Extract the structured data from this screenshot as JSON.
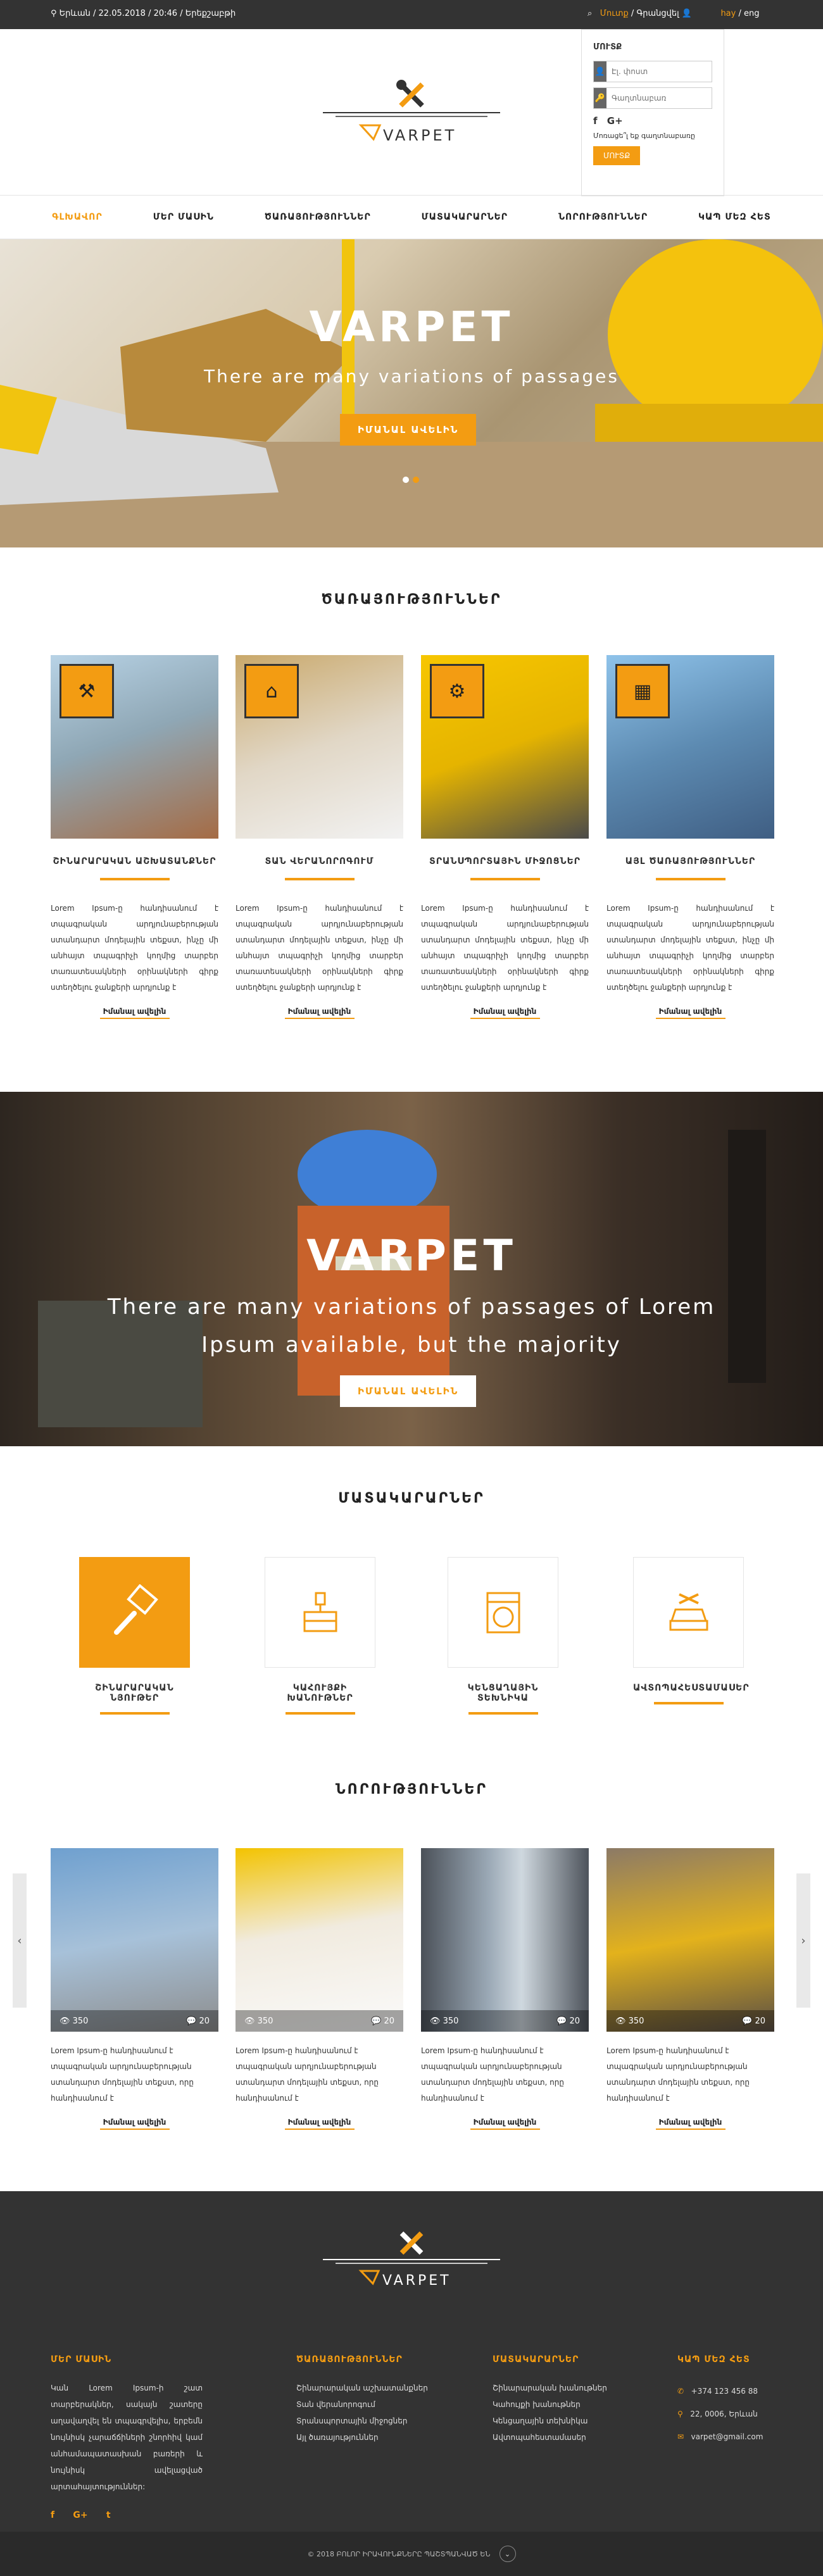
{
  "topbar": {
    "location": "Երևան / 22.05.2018 / 20:46 / Երեքշաբթի",
    "login": "Մուտք",
    "separator": " / ",
    "register": "Գրանցվել",
    "lang_hy": "hay",
    "lang_sep": " / ",
    "lang_en": "eng"
  },
  "login_panel": {
    "title": "ՄՈՒՏՔ",
    "email_placeholder": "Էլ. փոստ",
    "password_placeholder": "Գաղտնաբառ",
    "facebook": "f",
    "google": "G+",
    "forgot": "Մոռացե՞լ եք գաղտնաբառը",
    "button": "ՄՈՒՏՔ"
  },
  "logo": {
    "text": "VARPET"
  },
  "nav": {
    "items": [
      "ԳԼԽԱՎՈՐ",
      "ՄԵՐ ՄԱՍԻՆ",
      "ԾԱՌԱՅՈՒԹՅՈՒՆՆԵՐ",
      "ՄԱՏԱԿԱՐԱՐՆԵՐ",
      "ՆՈՐՈՒԹՅՈՒՆՆԵՐ",
      "ԿԱՊ ՄԵԶ ՀԵՏ"
    ]
  },
  "hero1": {
    "title": "VARPET",
    "subtitle": "There are many variations of passages",
    "button": "ԻՄԱՆԱԼ ԱՎԵԼԻՆ"
  },
  "services": {
    "title": "ԾԱՌԱՅՈՒԹՅՈՒՆՆԵՐ",
    "cards": [
      {
        "title": "ՇԻՆԱՐԱՐԱԿԱՆ ԱՇԽԱՏԱՆՔՆԵՐ",
        "text": "Lorem Ipsum-ը հանդիսանում է տպագրական արդյունաբերության ստանդարտ մոդելային տեքստ, ինչը մի անհայտ տպագրիչի կողմից տարբեր տառատեսակների օրինակների գիրք ստեղծելու ջանքերի արդյունք է",
        "more": "Իմանալ ավելին",
        "icon": "tools-icon"
      },
      {
        "title": "ՏԱՆ ՎԵՐԱՆՈՐՈԳՈՒՄ",
        "text": "Lorem Ipsum-ը հանդիսանում է տպագրական արդյունաբերության ստանդարտ մոդելային տեքստ, ինչը մի անհայտ տպագրիչի կողմից տարբեր տառատեսակների օրինակների գիրք ստեղծելու ջանքերի արդյունք է",
        "more": "Իմանալ ավելին",
        "icon": "house-icon"
      },
      {
        "title": "ՏՐԱՆՍՊՈՐՏԱՅԻՆ ՄԻՋՈՑՆԵՐ",
        "text": "Lorem Ipsum-ը հանդիսանում է տպագրական արդյունաբերության ստանդարտ մոդելային տեքստ, ինչը մի անհայտ տպագրիչի կողմից տարբեր տառատեսակների օրինակների գիրք ստեղծելու ջանքերի արդյունք է",
        "more": "Իմանալ ավելին",
        "icon": "gear-icon"
      },
      {
        "title": "ԱՅԼ ԾԱՌԱՅՈՒԹՅՈՒՆՆԵՐ",
        "text": "Lorem Ipsum-ը հանդիսանում է տպագրական արդյունաբերության ստանդարտ մոդելային տեքստ, ինչը մի անհայտ տպագրիչի կողմից տարբեր տառատեսակների օրինակների գիրք ստեղծելու ջանքերի արդյունք է",
        "more": "Իմանալ ավելին",
        "icon": "blueprint-icon"
      }
    ]
  },
  "hero2": {
    "title": "VARPET",
    "subtitle1": "There are many variations of passages of Lorem",
    "subtitle2": "Ipsum available, but the majority",
    "button": "ԻՄԱՆԱԼ ԱՎԵԼԻՆ"
  },
  "suppliers": {
    "title": "ՄԱՏԱԿԱՐԱՐՆԵՐ",
    "items": [
      {
        "label": "ՇԻՆԱՐԱՐԱԿԱՆ ՆՅՈՒԹԵՐ",
        "icon": "paint-brush-icon"
      },
      {
        "label": "ԿԱՀՈՒՅՔԻ ԽԱՆՈՒԹՆԵՐ",
        "icon": "furniture-icon"
      },
      {
        "label": "ԿԵՆՑԱՂԱՅԻՆ ՏԵԽՆԻԿԱ",
        "icon": "washing-machine-icon"
      },
      {
        "label": "ԱՎՏՈՊԱՀԵՍՏԱՄԱՍԵՐ",
        "icon": "car-repair-icon"
      }
    ]
  },
  "news": {
    "title": "ՆՈՐՈՒԹՅՈՒՆՆԵՐ",
    "items": [
      {
        "views": "350",
        "comments": "20",
        "text": "Lorem Ipsum-ը հանդիսանում է տպագրական արդյունաբերության ստանդարտ մոդելային տեքստ, որը հանդիսանում է",
        "more": "Իմանալ ավելին"
      },
      {
        "views": "350",
        "comments": "20",
        "text": "Lorem Ipsum-ը հանդիսանում է տպագրական արդյունաբերության ստանդարտ մոդելային տեքստ, որը հանդիսանում է",
        "more": "Իմանալ ավելին"
      },
      {
        "views": "350",
        "comments": "20",
        "text": "Lorem Ipsum-ը հանդիսանում է տպագրական արդյունաբերության ստանդարտ մոդելային տեքստ, որը հանդիսանում է",
        "more": "Իմանալ ավելին"
      },
      {
        "views": "350",
        "comments": "20",
        "text": "Lorem Ipsum-ը հանդիսանում է տպագրական արդյունաբերության ստանդարտ մոդելային տեքստ, որը հանդիսանում է",
        "more": "Իմանալ ավելին"
      }
    ],
    "prev": "‹",
    "next": "›"
  },
  "footer": {
    "logo_text": "VARPET",
    "about_head": "ՄԵՐ ՄԱՍԻՆ",
    "about_text": "Կան Lorem Ipsum-ի շատ տարբերակներ, սակայն շատերը աղավաղվել են տպագրվելիս, երբեմն նույնիսկ չարաճճիների շնորհիվ կամ անհամապատասխան բառերի և նույնիսկ ավելացված արտահայտություններ:",
    "services_head": "ԾԱՌԱՅՈՒԹՅՈՒՆՆԵՐ",
    "services_links": [
      "Շինարարական աշխատանքներ",
      "Տան վերանորոգում",
      "Տրանսպորտային միջոցներ",
      "Այլ ծառայություններ"
    ],
    "suppliers_head": "ՄԱՏԱԿԱՐԱՐՆԵՐ",
    "suppliers_links": [
      "Շինարարական խանութներ",
      "Կահույքի խանութներ",
      "Կենցաղային տեխնիկա",
      "Ավտոպահեստամասեր"
    ],
    "contact_head": "ԿԱՊ ՄԵԶ ՀԵՏ",
    "phone": "+374 123 456 88",
    "address": "22, 0006, Երևան",
    "email": "varpet@gmail.com",
    "social": [
      "f",
      "G+",
      "t"
    ],
    "copyright": "© 2018 ԲՈԼՈՐ ԻՐԱՎՈՒՆՔՆԵՐԸ ՊԱՇՏՊԱՆՎԱԾ ԵՆ"
  },
  "colors": {
    "accent": "#f39c12",
    "dark": "#333333"
  }
}
